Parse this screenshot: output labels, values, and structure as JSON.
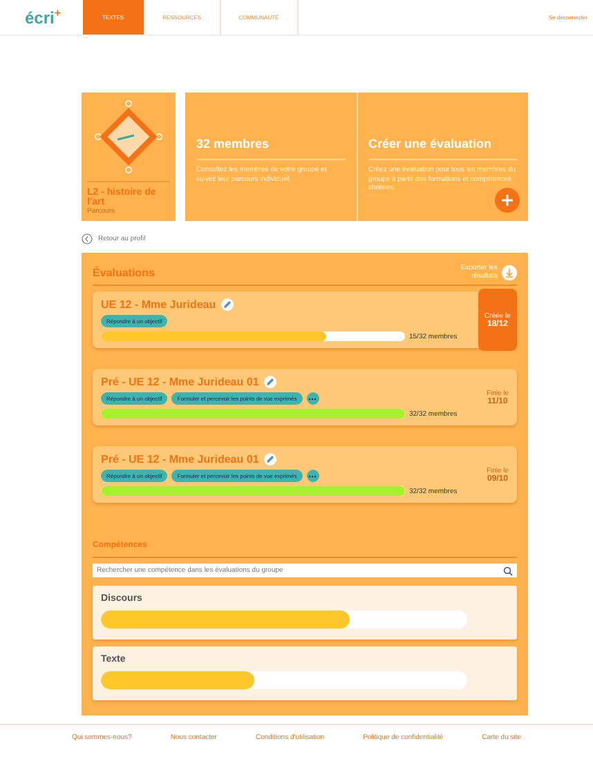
{
  "nav": {
    "logo": "écri$^{+}$",
    "tabs": [
      {
        "label": "TEXTES",
        "selected": true
      },
      {
        "label": "RESSOURCES",
        "selected": false
      },
      {
        "label": "COMMUNAUTÉ",
        "selected": false
      }
    ],
    "logout": "Se déconnecter"
  },
  "group": {
    "title": "L2 - histoire de l'art",
    "subtitle": "Parcours"
  },
  "cards": [
    {
      "title": "32 membres",
      "description": "Consultez les membres de votre groupe et suivez leur parcours individuel.",
      "action": false
    },
    {
      "title": "Créer une évaluation",
      "description": "Créez une évaluation pour tous les membres du groupe à partir des formations et compétences choisies.",
      "action": true
    }
  ],
  "back": "Retour au profil",
  "evaluations": {
    "title": "Évaluations",
    "export": "Exporter les résultats",
    "items": [
      {
        "title": "UE 12 - Mme Jurideau",
        "tags": [
          "Répondre à un objectif"
        ],
        "more_button": false,
        "level": 0.74,
        "count": "15/32 membres",
        "date_label": "Créée le",
        "date": "18/12",
        "selected": true
      },
      {
        "title": "Pré - UE 12 - Mme Jurideau 01",
        "tags": [
          "Répondre à un objectif",
          "Formuler et percevoir les points de vue exprimés"
        ],
        "more_button": true,
        "level": 1,
        "count": "32/32 membres",
        "date_label": "Finie le",
        "date": "11/10",
        "selected": false
      },
      {
        "title": "Pré - UE 12 - Mme Jurideau 01",
        "tags": [
          "Répondre à un objectif",
          "Formuler et percevoir les points de vue exprimés"
        ],
        "more_button": true,
        "level": 1,
        "count": "32/32 membres",
        "date_label": "Finie le",
        "date": "09/10",
        "selected": false
      }
    ]
  },
  "skills": {
    "title": "Compétences",
    "placeholder": "Rechercher une compétence dans les évaluations du groupe",
    "items": [
      {
        "name": "Discours",
        "level": 0.68
      },
      {
        "name": "Texte",
        "level": 0.42
      }
    ]
  },
  "footer": [
    "Qui sommes-nous?",
    "Nous contacter",
    "Conditions d'utilisation",
    "Politique de confidentialité",
    "Carte du site"
  ]
}
